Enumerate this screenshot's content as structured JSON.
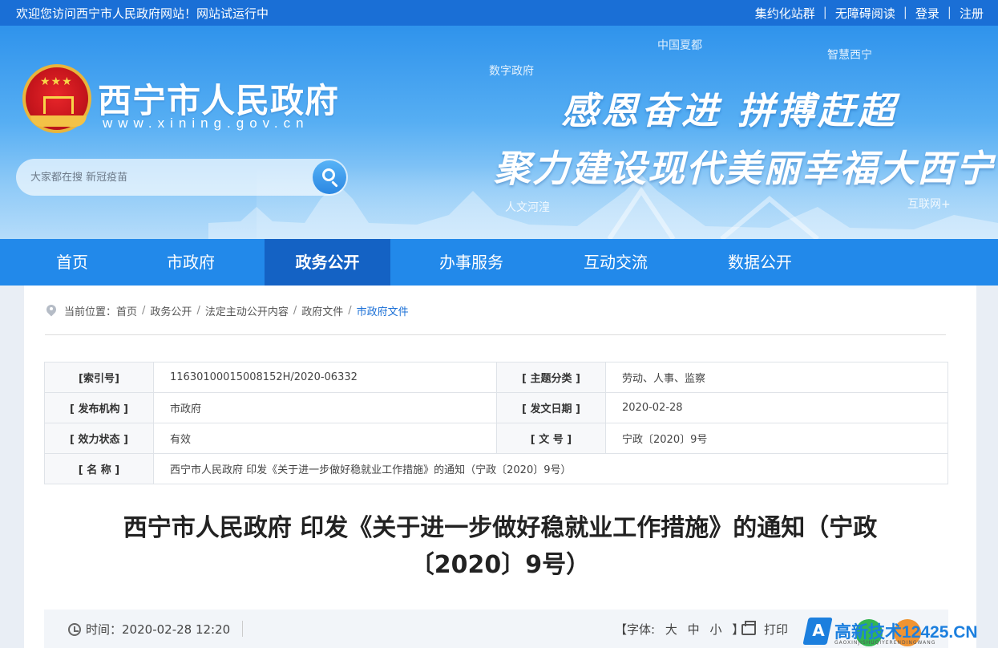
{
  "topbar": {
    "welcome": "欢迎您访问西宁市人民政府网站！网站试运行中",
    "links": [
      "集约化站群",
      "无障碍阅读",
      "登录",
      "注册"
    ],
    "separator": "|"
  },
  "header": {
    "site_name": "西宁市人民政府",
    "site_url": "www.xining.gov.cn",
    "search_placeholder": "大家都在搜 新冠疫苗",
    "slogan_line1": "感恩奋进 拼搏赶超",
    "slogan_line2": "聚力建设现代美丽幸福大西宁",
    "tags": {
      "t1": "中国夏都",
      "t2": "数字政府",
      "t3": "智慧西宁",
      "t4": "人文河湟",
      "t5": "互联网+"
    }
  },
  "nav": {
    "items": [
      "首页",
      "市政府",
      "政务公开",
      "办事服务",
      "互动交流",
      "数据公开"
    ],
    "active": "政务公开"
  },
  "breadcrumb": {
    "prefix": "当前位置：",
    "items": [
      "首页",
      "政务公开",
      "法定主动公开内容",
      "政府文件"
    ],
    "current": "市政府文件",
    "sep": "/"
  },
  "meta": {
    "index_key": "[索引号]",
    "index_val": "11630100015008152H/2020-06332",
    "topic_key": "[ 主题分类 ]",
    "topic_val": "劳动、人事、监察",
    "org_key": "[ 发布机构 ]",
    "org_val": "市政府",
    "date_key": "[ 发文日期 ]",
    "date_val": "2020-02-28",
    "status_key": "[ 效力状态 ]",
    "status_val": "有效",
    "docno_key": "[ 文 号 ]",
    "docno_val": "宁政〔2020〕9号",
    "name_key": "[ 名 称 ]",
    "name_val": "西宁市人民政府 印发《关于进一步做好稳就业工作措施》的通知（宁政〔2020〕9号）"
  },
  "document": {
    "title": "西宁市人民政府 印发《关于进一步做好稳就业工作措施》的通知（宁政〔2020〕9号）"
  },
  "infobar": {
    "time_label": "时间：",
    "time_value": "2020-02-28 12:20",
    "font_open": "【字体:",
    "font_large": "大",
    "font_medium": "中",
    "font_small": "小",
    "font_close": "】",
    "print": "打印"
  },
  "watermark": {
    "text": "高新技术12425.CN",
    "sub": "GAOXINJISHUQIYERENDINGWANG"
  },
  "colors": {
    "topbar": "#1a6fd6",
    "nav": "#2289ea",
    "nav_active": "#1462c4",
    "link_current": "#1a6fd6"
  }
}
